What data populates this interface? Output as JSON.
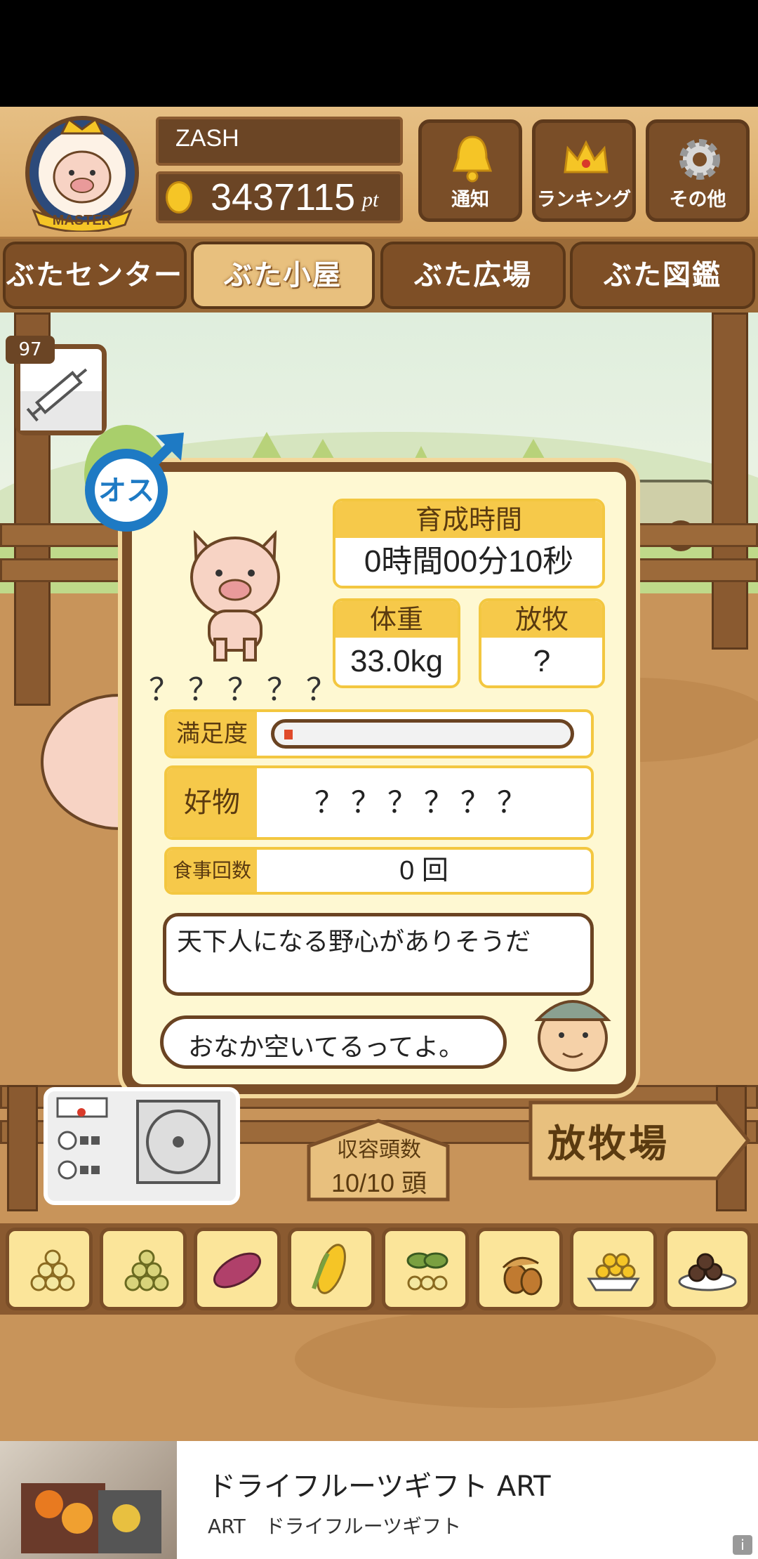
{
  "header": {
    "player_name": "ZASH",
    "points_value": "3437115",
    "points_unit": "pt",
    "badge_label": "MASTER",
    "buttons": [
      {
        "label": "通知",
        "icon": "bell-icon"
      },
      {
        "label": "ランキング",
        "icon": "crown-icon"
      },
      {
        "label": "その他",
        "icon": "gear-icon"
      }
    ]
  },
  "tabs": [
    {
      "label": "ぶたセンター",
      "active": false
    },
    {
      "label": "ぶた小屋",
      "active": true
    },
    {
      "label": "ぶた広場",
      "active": false
    },
    {
      "label": "ぶた図鑑",
      "active": false
    }
  ],
  "item": {
    "count": "97",
    "icon": "syringe-icon"
  },
  "pig_card": {
    "gender_label": "オス",
    "name": "？？？？？",
    "time_label": "育成時間",
    "time_value": "0時間00分10秒",
    "weight_label": "体重",
    "weight_value": "33.0kg",
    "graze_label": "放牧",
    "graze_value": "?",
    "satisfaction_label": "満足度",
    "satisfaction_level": 0.03,
    "favorite_label": "好物",
    "favorite_value": "？？？？？？",
    "meals_label": "食事回数",
    "meals_value": "0 回",
    "comment": "天下人になる野心がありそうだ",
    "farmer_message": "おなか空いてるってよ。"
  },
  "scene": {
    "capacity_label": "収容頭数",
    "capacity_value": "10/10 頭",
    "graze_sign": "放牧場"
  },
  "foods": [
    "grain-mix-icon",
    "grain-green-icon",
    "sweet-potato-icon",
    "corn-icon",
    "herb-icon",
    "acorn-icon",
    "grain-bowl-icon",
    "dumpling-plate-icon"
  ],
  "ad": {
    "title": "ドライフルーツギフト ART",
    "subtitle": "ART　ドライフルーツギフト",
    "info_icon": "i"
  },
  "colors": {
    "wood": "#7a4e28",
    "card_bg": "#fef8d2",
    "accent_yellow": "#f6c94a"
  }
}
